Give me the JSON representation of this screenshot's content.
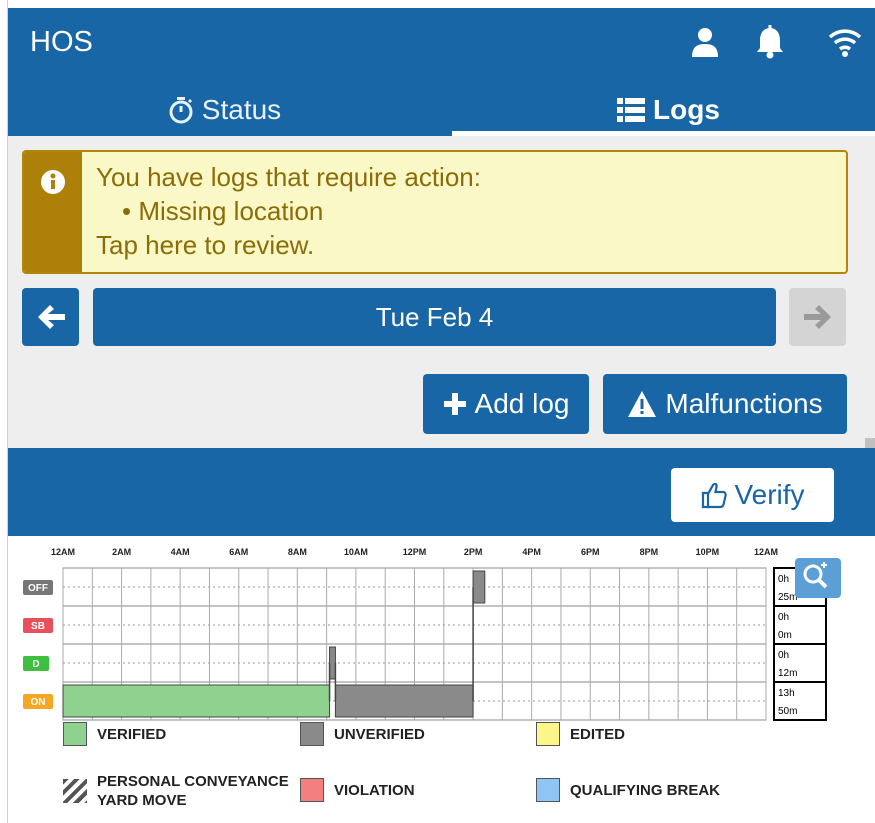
{
  "header": {
    "title": "HOS",
    "icons": [
      "user-icon",
      "bell-icon",
      "wifi-icon"
    ],
    "accent": "#1866a6"
  },
  "tabs": [
    {
      "label": "Status",
      "icon": "stopwatch-icon",
      "active": false
    },
    {
      "label": "Logs",
      "icon": "list-icon",
      "active": true
    }
  ],
  "alert": {
    "line1": "You have logs that require action:",
    "bullet": "Missing location",
    "line3": "Tap here to review.",
    "icon": "info-icon"
  },
  "date_nav": {
    "date": "Tue Feb 4",
    "prev_icon": "arrow-left-icon",
    "next_icon": "arrow-right-icon",
    "next_disabled": true
  },
  "actions": {
    "add_log": "Add log",
    "malfunctions": "Malfunctions"
  },
  "verify": {
    "label": "Verify",
    "icon": "thumbs-up-icon"
  },
  "chart_data": {
    "type": "step",
    "hour_labels": [
      "12AM",
      "2AM",
      "4AM",
      "6AM",
      "8AM",
      "10AM",
      "12PM",
      "2PM",
      "4PM",
      "6PM",
      "8PM",
      "10PM",
      "12AM"
    ],
    "rows": [
      {
        "code": "OFF",
        "color": "#777777",
        "total_h": "0h",
        "total_m": "25m"
      },
      {
        "code": "SB",
        "color": "#e8505b",
        "total_h": "0h",
        "total_m": "0m"
      },
      {
        "code": "D",
        "color": "#3fbf3f",
        "total_h": "0h",
        "total_m": "12m"
      },
      {
        "code": "ON",
        "color": "#f5a623",
        "total_h": "13h",
        "total_m": "50m"
      }
    ],
    "segments": [
      {
        "status": "ON",
        "start": 0.0,
        "end": 9.1,
        "state": "verified"
      },
      {
        "status": "D",
        "start": 9.1,
        "end": 9.3,
        "state": "unverified"
      },
      {
        "status": "ON",
        "start": 9.3,
        "end": 14.0,
        "state": "unverified"
      },
      {
        "status": "OFF",
        "start": 14.0,
        "end": 14.4,
        "state": "unverified"
      }
    ],
    "zoom_icon": "zoom-in-icon"
  },
  "legend": [
    {
      "label": "VERIFIED",
      "color": "#8fd18f"
    },
    {
      "label": "UNVERIFIED",
      "color": "#8a8a8a"
    },
    {
      "label": "EDITED",
      "color": "#fbf58a"
    },
    {
      "label": "PERSONAL CONVEYANCE",
      "label2": "YARD MOVE",
      "pattern": "hatched"
    },
    {
      "label": "VIOLATION",
      "color": "#f37f7f"
    },
    {
      "label": "QUALIFYING BREAK",
      "color": "#8fc4f4"
    }
  ]
}
